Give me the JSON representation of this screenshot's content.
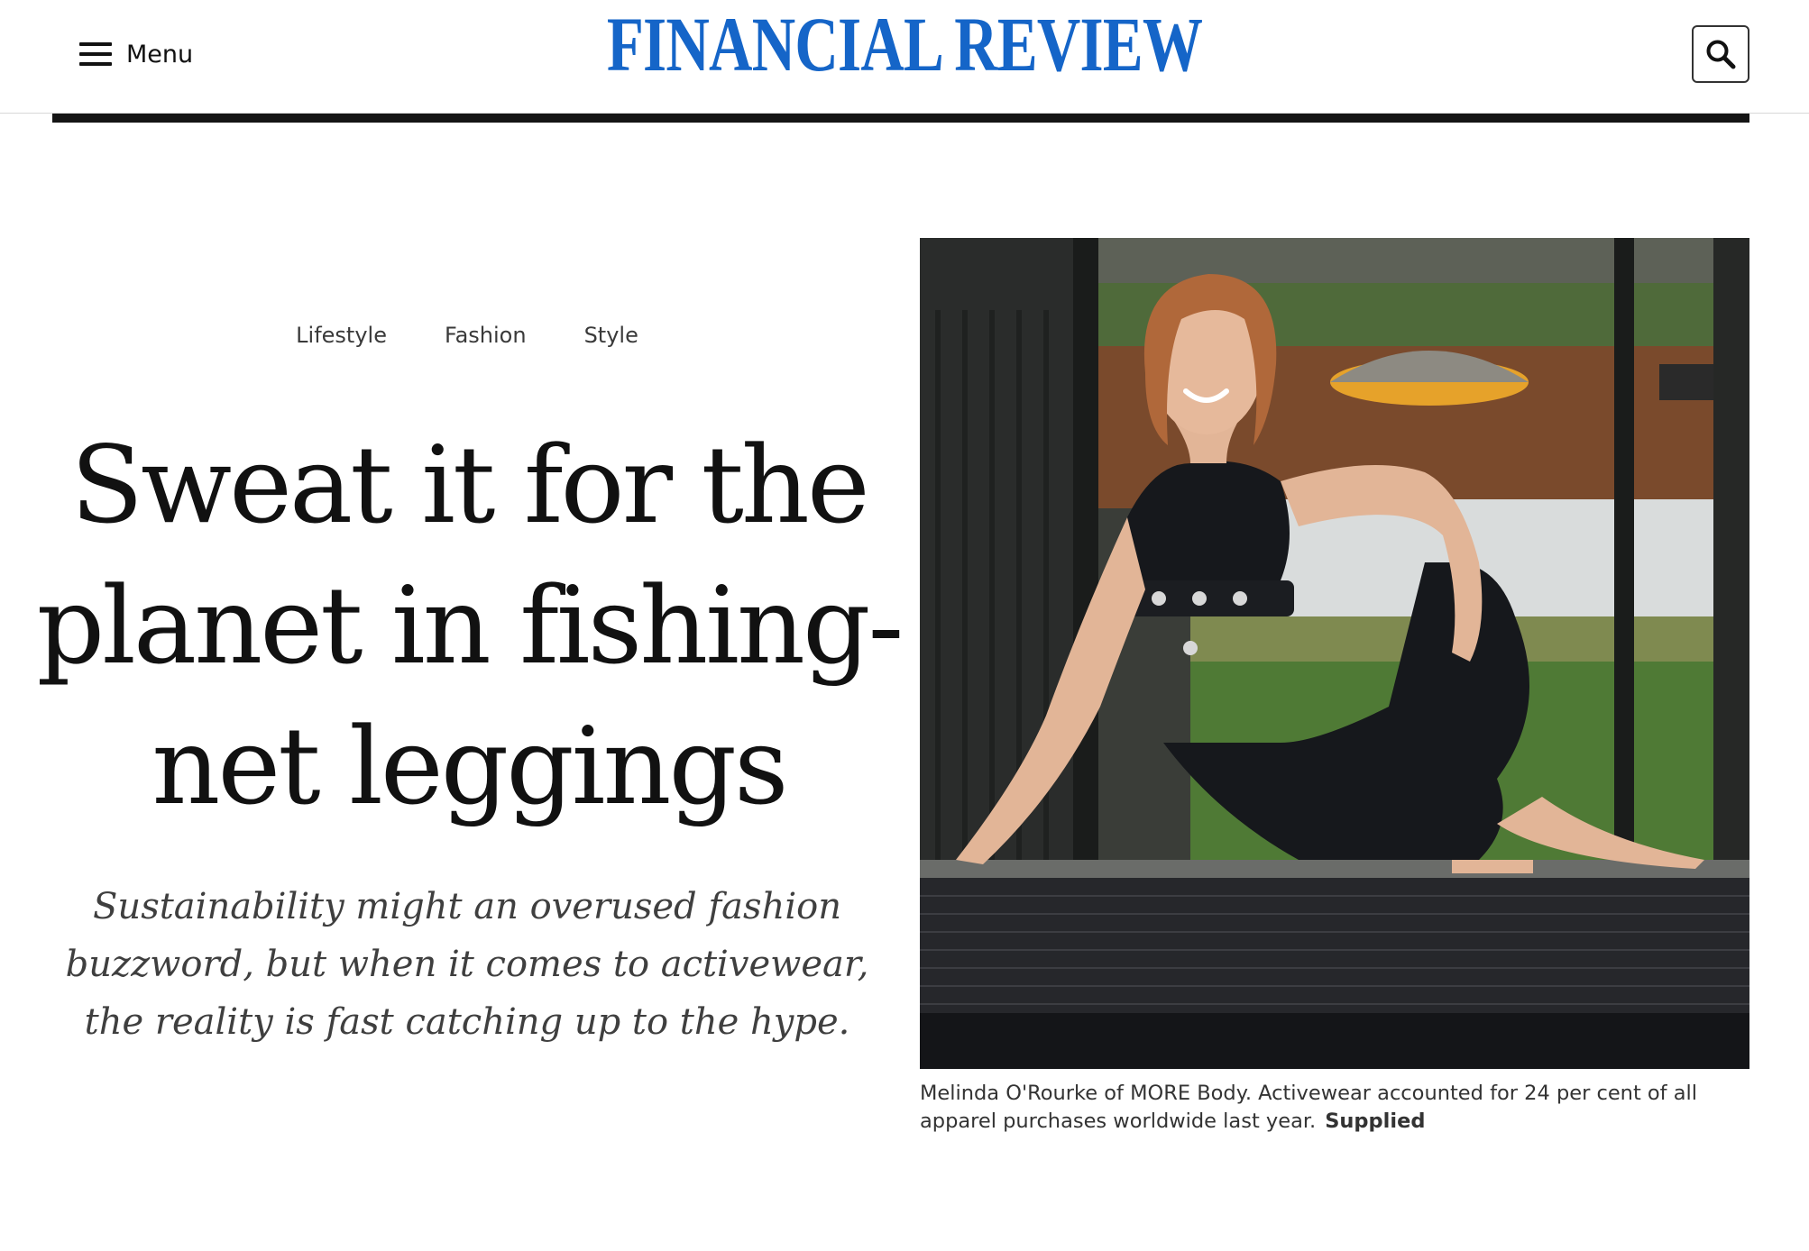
{
  "header": {
    "menu_label": "Menu",
    "masthead": "FINANCIAL REVIEW",
    "brand_color": "#1565c8",
    "menu_icon": "hamburger-icon",
    "search_icon": "search-icon"
  },
  "article": {
    "tags": [
      {
        "label": "Lifestyle"
      },
      {
        "label": "Fashion"
      },
      {
        "label": "Style"
      }
    ],
    "headline": "Sweat it for the planet in fishing-net leggings",
    "standfirst": "Sustainability might an overused fashion buzzword, but when it comes to activewear, the reality is fast catching up to the hype.",
    "image": {
      "caption": "Melinda O'Rourke of MORE Body. Activewear accounted for 24 per cent of all apparel purchases worldwide last year.",
      "credit": "Supplied"
    }
  }
}
